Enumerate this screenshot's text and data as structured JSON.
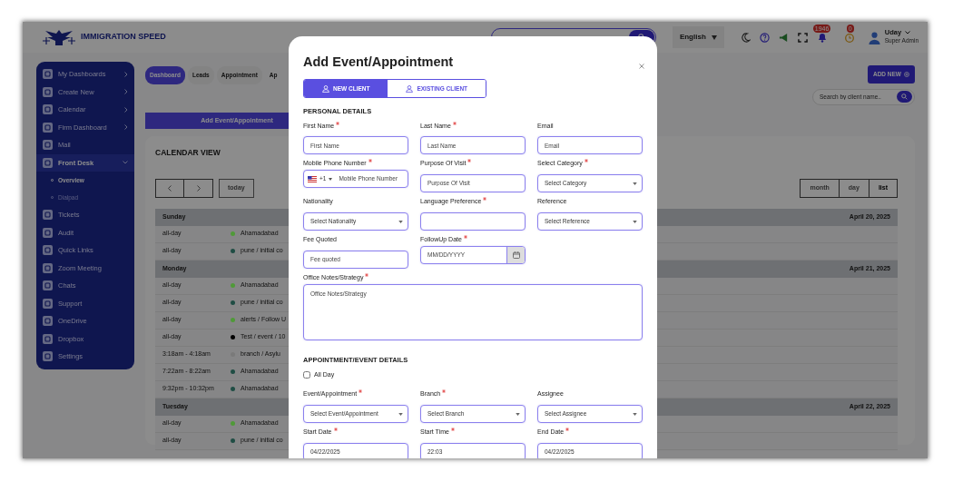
{
  "header": {
    "logo_text": "IMMIGRATION SPEED",
    "language": "English",
    "notifications_count": "1946",
    "reminders_count": "0",
    "user_name": "Uday",
    "user_role": "Super Admin"
  },
  "sidebar": {
    "items": [
      {
        "label": "My Dashboards",
        "expanded": false,
        "selected": false
      },
      {
        "label": "Create New",
        "expanded": false,
        "selected": false
      },
      {
        "label": "Calendar",
        "expanded": false,
        "selected": false
      },
      {
        "label": "Firm Dashboard",
        "expanded": false,
        "selected": false
      },
      {
        "label": "Mail",
        "selected": false
      },
      {
        "label": "Front Desk",
        "expanded": true,
        "selected": true,
        "children": [
          {
            "label": "Overview",
            "selected": true
          },
          {
            "label": "Dialpad",
            "selected": false
          }
        ]
      },
      {
        "label": "Tickets",
        "selected": false
      },
      {
        "label": "Audit",
        "selected": false
      },
      {
        "label": "Quick Links",
        "selected": false
      },
      {
        "label": "Zoom Meeting",
        "selected": false
      },
      {
        "label": "Chats",
        "selected": false
      },
      {
        "label": "Support",
        "selected": false
      },
      {
        "label": "OneDrive",
        "selected": false
      },
      {
        "label": "Dropbox",
        "selected": false
      },
      {
        "label": "Settings",
        "selected": false
      }
    ]
  },
  "tabs": [
    {
      "label": "Dashboard",
      "selected": true
    },
    {
      "label": "Leads",
      "selected": false
    },
    {
      "label": "Appointment",
      "selected": false
    },
    {
      "label": "Ap",
      "selected": false
    }
  ],
  "add_new_button": "ADD NEW",
  "client_search": {
    "placeholder": "Search by client name.."
  },
  "add_event_button": "Add Event/Appointment",
  "calendar": {
    "title": "CALENDAR VIEW",
    "today_button": "today",
    "views": [
      {
        "label": "month",
        "selected": false
      },
      {
        "label": "day",
        "selected": false
      },
      {
        "label": "list",
        "selected": true
      }
    ],
    "days": [
      {
        "day": "Sunday",
        "date": "April 20, 2025",
        "events": [
          {
            "time": "all-day",
            "title": "Ahamadabad",
            "color": "#4f9a38"
          },
          {
            "time": "all-day",
            "title": "pune / initial co",
            "color": "#1f4d44"
          }
        ]
      },
      {
        "day": "Monday",
        "date": "April 21, 2025",
        "events": [
          {
            "time": "all-day",
            "title": "Ahamadabad",
            "color": "#4f9a38"
          },
          {
            "time": "all-day",
            "title": "pune / initial co",
            "color": "#1f4d44"
          },
          {
            "time": "all-day",
            "title": "alerts / Follow U",
            "color": "#4f9a38"
          },
          {
            "time": "all-day",
            "title": "Test / event / 10",
            "color": "#000000"
          },
          {
            "time": "3:18am - 4:18am",
            "title": "branch / Asylu",
            "color": "#7a7a7a"
          },
          {
            "time": "7:22am - 8:22am",
            "title": "Ahamadabad",
            "color": "#1f4d44"
          },
          {
            "time": "9:32pm - 10:32pm",
            "title": "Ahamadabad",
            "color": "#1f4d44"
          }
        ]
      },
      {
        "day": "Tuesday",
        "date": "April 22, 2025",
        "events": [
          {
            "time": "all-day",
            "title": "Ahamadabad",
            "color": "#4f9a38"
          },
          {
            "time": "all-day",
            "title": "pune / initial co",
            "color": "#1f4d44"
          }
        ]
      }
    ]
  },
  "modal": {
    "title": "Add Event/Appointment",
    "client_tabs": [
      {
        "label": "NEW CLIENT",
        "selected": true
      },
      {
        "label": "EXISTING CLIENT",
        "selected": false
      }
    ],
    "sections": [
      {
        "title": "PERSONAL DETAILS",
        "fields": [
          {
            "kind": "text",
            "label": "First Name",
            "required": true,
            "placeholder": "First Name"
          },
          {
            "kind": "text",
            "label": "Last Name",
            "required": true,
            "placeholder": "Last Name"
          },
          {
            "kind": "text",
            "label": "Email",
            "required": false,
            "placeholder": "Email"
          },
          {
            "kind": "phone",
            "label": "Mobile Phone Number",
            "required": true,
            "country_code": "+1",
            "placeholder": "Mobile Phone Number"
          },
          {
            "kind": "text",
            "label": "Purpose Of Visit",
            "required": true,
            "placeholder": "Purpose Of Visit"
          },
          {
            "kind": "select",
            "label": "Select Category",
            "required": true,
            "placeholder": "Select Category"
          },
          {
            "kind": "select",
            "label": "Nationality",
            "required": false,
            "placeholder": "Select Nationality"
          },
          {
            "kind": "text",
            "label": "Language Preference",
            "required": true
          },
          {
            "kind": "select",
            "label": "Reference",
            "required": false,
            "placeholder": "Select Reference"
          },
          {
            "kind": "text",
            "label": "Fee Quoted",
            "required": false,
            "placeholder": "Fee quoted"
          },
          {
            "kind": "date",
            "label": "FollowUp Date",
            "required": true,
            "placeholder": "MM/DD/YYYY"
          },
          {
            "kind": "textarea",
            "label": "Office Notes/Strategy",
            "required": true,
            "placeholder": "Office Notes/Strategy"
          }
        ]
      },
      {
        "title": "APPOINTMENT/EVENT DETAILS",
        "fields": [
          {
            "kind": "checkbox",
            "label": "All Day",
            "checked": false
          },
          {
            "kind": "select",
            "label": "Event/Appointment",
            "required": true,
            "placeholder": "Select Event/Appointment"
          },
          {
            "kind": "select",
            "label": "Branch",
            "required": true,
            "placeholder": "Select Branch"
          },
          {
            "kind": "select",
            "label": "Assignee",
            "required": false,
            "placeholder": "Select Assignee"
          },
          {
            "kind": "text",
            "label": "Start Date",
            "required": true,
            "value": "04/22/2025"
          },
          {
            "kind": "text",
            "label": "Start Time",
            "required": true,
            "value": "22:03"
          },
          {
            "kind": "text",
            "label": "End Date",
            "required": true,
            "value": "04/22/2025"
          }
        ]
      }
    ]
  }
}
